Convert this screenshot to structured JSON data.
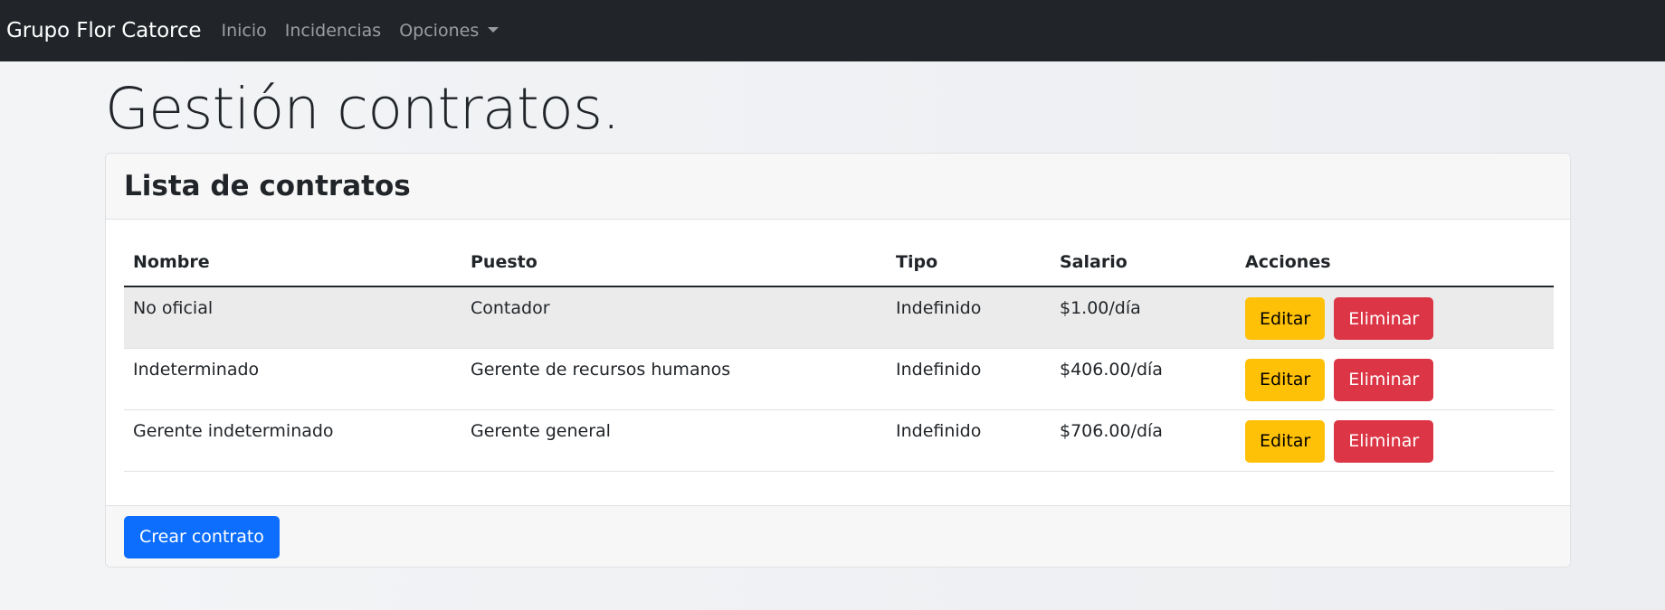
{
  "navbar": {
    "brand": "Grupo Flor Catorce",
    "links": [
      "Inicio",
      "Incidencias",
      "Opciones"
    ],
    "dropdown_icon": "caret-down-icon"
  },
  "main": {
    "title": "Gestión contratos."
  },
  "card": {
    "title": "Lista de contratos",
    "columns": [
      "Nombre",
      "Puesto",
      "Tipo",
      "Salario",
      "Acciones"
    ],
    "rows": [
      {
        "nombre": "No oficial",
        "puesto": "Contador",
        "tipo": "Indefinido",
        "salario": "$1.00/día",
        "edit_label": "Editar",
        "delete_label": "Eliminar"
      },
      {
        "nombre": "Indeterminado",
        "puesto": "Gerente de recursos humanos",
        "tipo": "Indefinido",
        "salario": "$406.00/día",
        "edit_label": "Editar",
        "delete_label": "Eliminar"
      },
      {
        "nombre": "Gerente indeterminado",
        "puesto": "Gerente general",
        "tipo": "Indefinido",
        "salario": "$706.00/día",
        "edit_label": "Editar",
        "delete_label": "Eliminar"
      }
    ],
    "footer_button": "Crear contrato"
  },
  "colors": {
    "navbar_bg": "#212529",
    "edit_button": "#ffc107",
    "delete_button": "#dc3545",
    "primary_button": "#0d6efd"
  }
}
